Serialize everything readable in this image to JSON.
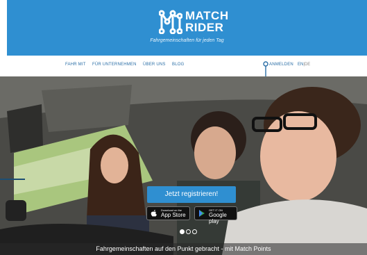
{
  "brand": {
    "name_line1": "MATCH",
    "name_line2": "RIDER",
    "tagline": "Fahrgemeinschaften für jeden Tag"
  },
  "nav": {
    "items": [
      "FAHR MIT",
      "FÜR UNTERNEHMEN",
      "ÜBER UNS",
      "BLOG"
    ],
    "login": "ANMELDEN",
    "lang_en": "EN",
    "lang_sep": "|",
    "lang_de": "DE"
  },
  "hero": {
    "cta_label": "Jetzt registrieren!",
    "appstore_small": "Download on the",
    "appstore_big": "App Store",
    "googleplay_small": "GET IT ON",
    "googleplay_big": "Google play",
    "caption": "Fahrgemeinschaften auf den Punkt gebracht - mit Match Points"
  },
  "colors": {
    "header_blue": "#2f8fd1",
    "nav_text": "#2a6ea6"
  }
}
